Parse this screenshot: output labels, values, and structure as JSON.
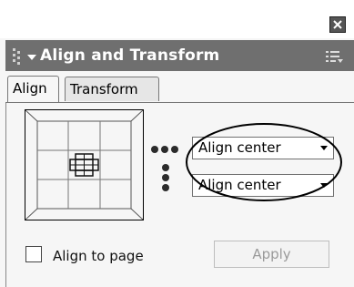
{
  "panel": {
    "title": "Align and Transform",
    "close_icon": "close-icon",
    "options_icon": "options-menu-icon",
    "collapse_icon": "triangle-down-icon"
  },
  "tabs": [
    {
      "label": "Align",
      "active": true
    },
    {
      "label": "Transform",
      "active": false
    }
  ],
  "align": {
    "horizontal_select": {
      "value": "Align center",
      "icon": "horizontal-dots-icon"
    },
    "vertical_select": {
      "value": "Align center",
      "icon": "vertical-dots-icon"
    },
    "align_to_page_label": "Align to page",
    "align_to_page_checked": false,
    "apply_label": "Apply",
    "apply_enabled": false
  },
  "colors": {
    "header_bg": "#6f6f6f",
    "panel_bg": "#f6f6f6",
    "disabled_text": "#9a9a9a"
  }
}
